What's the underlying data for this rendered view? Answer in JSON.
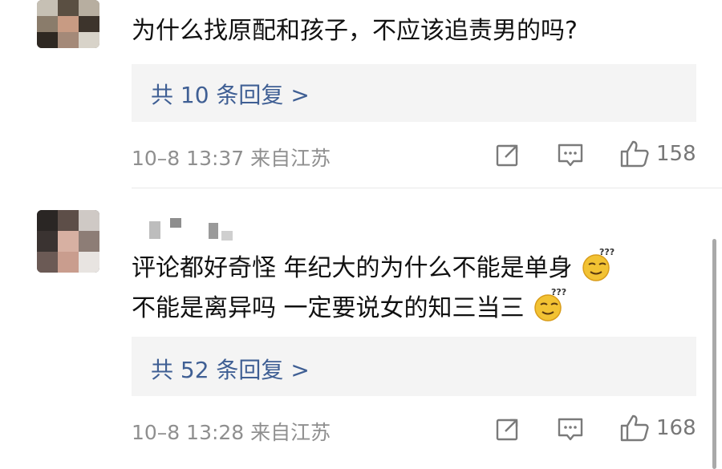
{
  "comments": [
    {
      "text": "为什么找原配和孩子，不应该追责男的吗?",
      "replies": "共 10 条回复 >",
      "meta": "10–8 13:37 来自江苏",
      "likes": "158"
    },
    {
      "line1": "评论都好奇怪  年纪大的为什么不能是单身",
      "line2": "不能是离异吗  一定要说女的知三当三",
      "replies": "共 52 条回复 >",
      "meta": "10–8 13:28 来自江苏",
      "likes": "168"
    }
  ],
  "icons": [
    "share-icon",
    "comment-icon",
    "like-icon",
    "thinking-emoji-icon"
  ],
  "colors": {
    "reply_link": "#3f5f94",
    "meta": "#8f8f8f",
    "reply_bg": "#f4f4f4"
  }
}
